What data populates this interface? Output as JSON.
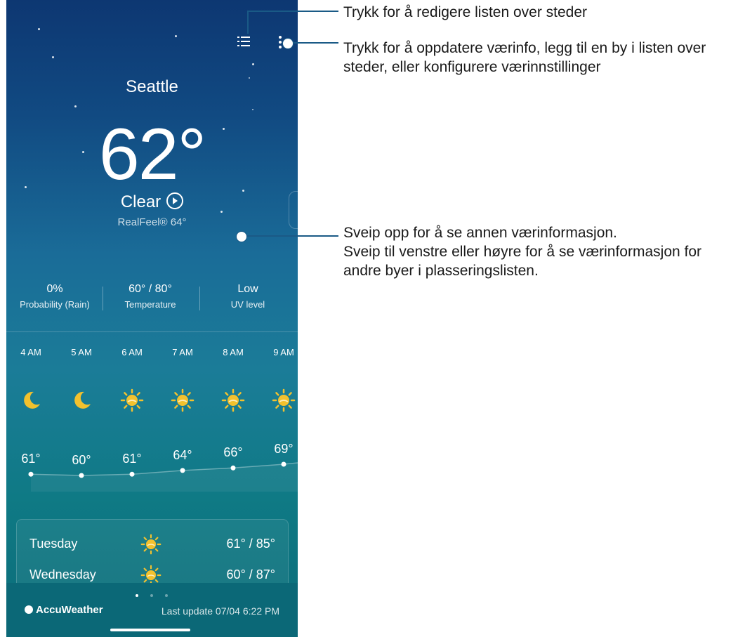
{
  "header": {
    "city": "Seattle"
  },
  "current": {
    "temperature": "62°",
    "condition": "Clear",
    "realfeel": "RealFeel® 64°"
  },
  "stats": [
    {
      "value": "0%",
      "label": "Probability (Rain)"
    },
    {
      "value": "60° / 80°",
      "label": "Temperature"
    },
    {
      "value": "Low",
      "label": "UV level"
    }
  ],
  "hourly": [
    {
      "time": "4 AM",
      "icon": "moon-icon",
      "temp": "61°",
      "temp_value": 61
    },
    {
      "time": "5 AM",
      "icon": "moon-icon",
      "temp": "60°",
      "temp_value": 60
    },
    {
      "time": "6 AM",
      "icon": "sun-icon",
      "temp": "61°",
      "temp_value": 61
    },
    {
      "time": "7 AM",
      "icon": "sun-icon",
      "temp": "64°",
      "temp_value": 64
    },
    {
      "time": "8 AM",
      "icon": "sun-icon",
      "temp": "66°",
      "temp_value": 66
    },
    {
      "time": "9 AM",
      "icon": "sun-icon",
      "temp": "69°",
      "temp_value": 69
    }
  ],
  "daily": [
    {
      "day": "Tuesday",
      "icon": "sun-icon",
      "range": "61° / 85°"
    },
    {
      "day": "Wednesday",
      "icon": "sun-icon",
      "range": "60° / 87°"
    }
  ],
  "footer": {
    "brand": "AccuWeather",
    "last_update": "Last update 07/04 6:22 PM",
    "page_count": 3,
    "active_page": 1
  },
  "callouts": {
    "edit_list": "Trykk for å redigere listen over steder",
    "more_options_line1": "Trykk for å oppdatere værinfo, legg til en by i listen over",
    "more_options_line2": "steder, eller konfigurere værinnstillinger",
    "swipe_line1": "Sveip opp for å se annen værinformasjon.",
    "swipe_line2": "Sveip til venstre eller høyre for å se værinformasjon for",
    "swipe_line3": "andre byer i plasseringslisten."
  },
  "colors": {
    "sun": "#f2c12e",
    "moon": "#f2c12e",
    "callout_line": "#1a5a86"
  }
}
